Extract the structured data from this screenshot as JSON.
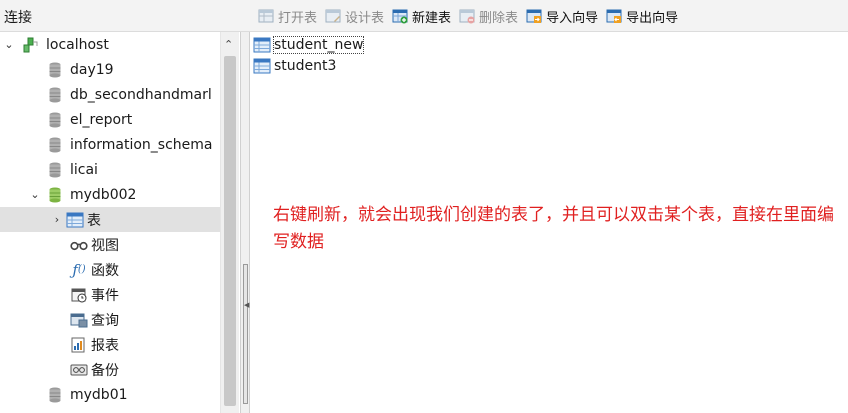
{
  "connection_panel": {
    "title": "连接"
  },
  "toolbar": {
    "open_table": "打开表",
    "design_table": "设计表",
    "new_table": "新建表",
    "delete_table": "删除表",
    "import_wizard": "导入向导",
    "export_wizard": "导出向导"
  },
  "tree": {
    "connection": "localhost",
    "databases": [
      "day19",
      "db_secondhandmarl",
      "el_report",
      "information_schema",
      "licai"
    ],
    "open_database": "mydb002",
    "children": [
      "表",
      "视图",
      "函数",
      "事件",
      "查询",
      "报表",
      "备份"
    ],
    "after_database": "mydb01"
  },
  "tables": [
    "student_new",
    "student3"
  ],
  "annotation": "右键刷新，就会出现我们创建的表了，并且可以双击某个表，直接在里面编写数据",
  "colors": {
    "annotation": "#e02020",
    "selected_row": "#e1e1e1"
  }
}
